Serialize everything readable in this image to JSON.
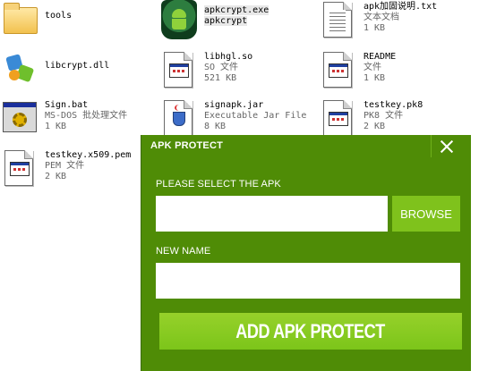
{
  "files": [
    {
      "id": "tools",
      "name": "tools",
      "type": "",
      "size": ""
    },
    {
      "id": "apkcrypt",
      "name": "apkcrypt.exe",
      "type": "apkcrypt",
      "size": ""
    },
    {
      "id": "apkdoc",
      "name": "apk加固说明.txt",
      "type": "文本文档",
      "size": "1 KB"
    },
    {
      "id": "libcrypt",
      "name": "libcrypt.dll",
      "type": "",
      "size": ""
    },
    {
      "id": "libhgl",
      "name": "libhgl.so",
      "type": "SO 文件",
      "size": "521 KB"
    },
    {
      "id": "readme",
      "name": "README",
      "type": "文件",
      "size": "1 KB"
    },
    {
      "id": "signbat",
      "name": "Sign.bat",
      "type": "MS-DOS 批处理文件",
      "size": "1 KB"
    },
    {
      "id": "signapk",
      "name": "signapk.jar",
      "type": "Executable Jar File",
      "size": "8 KB"
    },
    {
      "id": "testkeypk8",
      "name": "testkey.pk8",
      "type": "PK8 文件",
      "size": "2 KB"
    },
    {
      "id": "testkeypem",
      "name": "testkey.x509.pem",
      "type": "PEM 文件",
      "size": "2 KB"
    }
  ],
  "dialog": {
    "title": "APK PROTECT",
    "select_label": "PLEASE SELECT THE APK",
    "apk_path": "",
    "browse_label": "BROWSE",
    "newname_label": "NEW NAME",
    "new_name": "",
    "add_label": "ADD APK PROTECT"
  },
  "colors": {
    "dialog_bg": "#4f8c06",
    "button_bg": "#7fc21c"
  }
}
